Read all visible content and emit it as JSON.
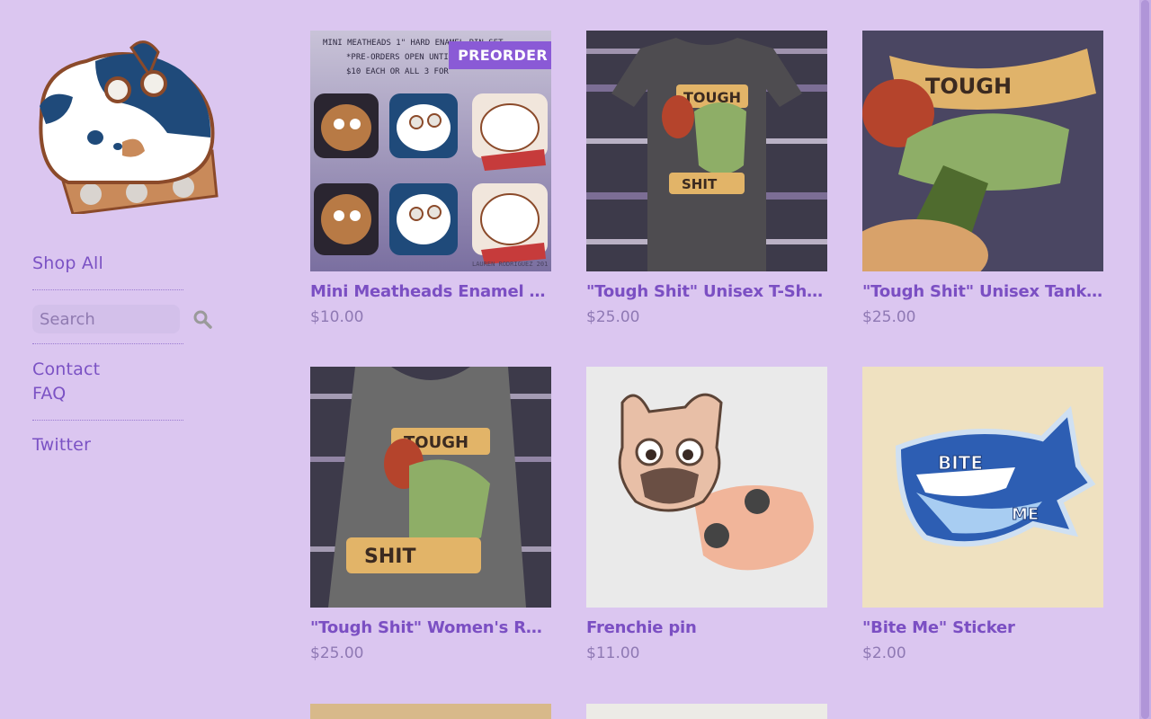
{
  "sidebar": {
    "logo_name": "store-logo",
    "shop_all": "Shop All",
    "search_placeholder": "Search",
    "contact": "Contact",
    "faq": "FAQ",
    "twitter": "Twitter"
  },
  "products": [
    {
      "title": "Mini Meatheads Enamel Pin Set",
      "price": "$10.00",
      "badge": "PREORDER",
      "image_text": {
        "line1": "MINI MEATHEADS 1\" HARD ENAMEL PIN SET",
        "line2": "*PRE-ORDERS OPEN UNTIL",
        "line3": "$10 EACH OR ALL 3 FOR",
        "credit": "LAUREN RODRIGUEZ 201"
      }
    },
    {
      "title": "\"Tough Shit\" Unisex T-Shirt",
      "price": "$25.00"
    },
    {
      "title": "\"Tough Shit\" Unisex Tank Top",
      "price": "$25.00"
    },
    {
      "title": "\"Tough Shit\" Women's Racerback Tank",
      "price": "$25.00"
    },
    {
      "title": "Frenchie pin",
      "price": "$11.00"
    },
    {
      "title": "\"Bite Me\" Sticker",
      "price": "$2.00"
    }
  ],
  "art_text": {
    "tough": "TOUGH",
    "shit": "SHIT",
    "tough_tank": "TOUGH",
    "bite": "BITE",
    "me": "ME"
  },
  "colors": {
    "background": "#dbc6f0",
    "accent": "#7b4fc3",
    "price": "#8f79b4",
    "badge": "#8a5ad6"
  }
}
